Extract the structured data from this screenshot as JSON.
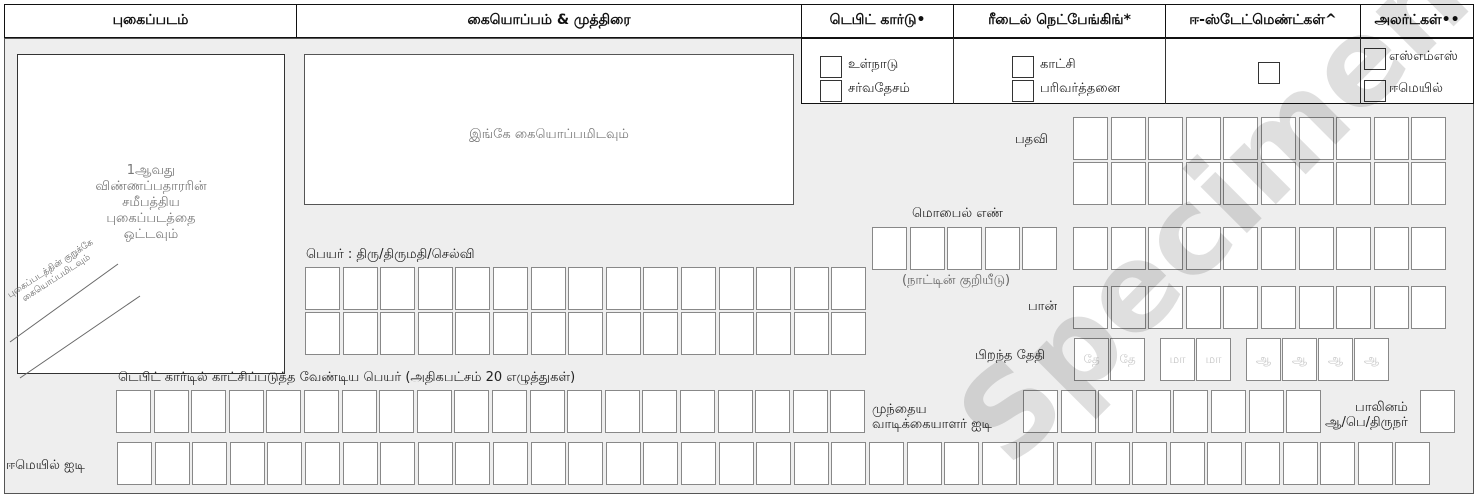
{
  "headers": {
    "photo": "புகைப்படம்",
    "signature": "கையொப்பம் & முத்திரை",
    "debit_card": "டெபிட் கார்டு•",
    "net_banking": "ரீடைல் நெட்பேங்கிங்*",
    "estatements": "ஈ-ஸ்டேட்மெண்ட்கள்^",
    "alerts": "அலர்ட்கள்••"
  },
  "photo_box": {
    "line1": "1ஆவது",
    "line2": "விண்ணப்பதாரரின்",
    "line3": "சமீபத்திய",
    "line4": "புகைப்படத்தை",
    "line5": "ஒட்டவும்",
    "cross_line1": "புகைப்படத்தின் குறுக்கே",
    "cross_line2": "கையொப்பமிடவும்"
  },
  "signature_box": {
    "text": "இங்கே கையொப்பமிடவும்"
  },
  "debit_options": [
    "உள்நாடு",
    "சர்வதேசம்"
  ],
  "netbanking_options": [
    "காட்சி",
    "பரிவர்த்தனை"
  ],
  "alert_options": [
    "எஸ்எம்எஸ்",
    "ஈமெயில்"
  ],
  "fields": {
    "designation": "பதவி",
    "mobile": "மொபைல் எண்",
    "country_code": "(நாட்டின் குறியீடு)",
    "pan": "பான்",
    "dob": "பிறந்த தேதி",
    "name": "பெயர் : திரு/திருமதி/செல்வி",
    "card_name": "டெபிட் கார்டில் காட்சிப்படுத்த வேண்டிய பெயர் (அதிகபட்சம் 20 எழுத்துகள்)",
    "customer_id_line1": "முந்தைய",
    "customer_id_line2": "வாடிக்கையாளர் ஐடி",
    "gender_line1": "பாலினம்",
    "gender_line2": "ஆ/பெ/திருநர்",
    "email": "ஈமெயில் ஐடி"
  },
  "dob_placeholders": [
    "தே",
    "தே",
    "மா",
    "மா",
    "ஆ",
    "ஆ",
    "ஆ",
    "ஆ"
  ],
  "watermark": "Specimen",
  "colors": {
    "panel": "#eeeeee",
    "border": "#111111"
  }
}
